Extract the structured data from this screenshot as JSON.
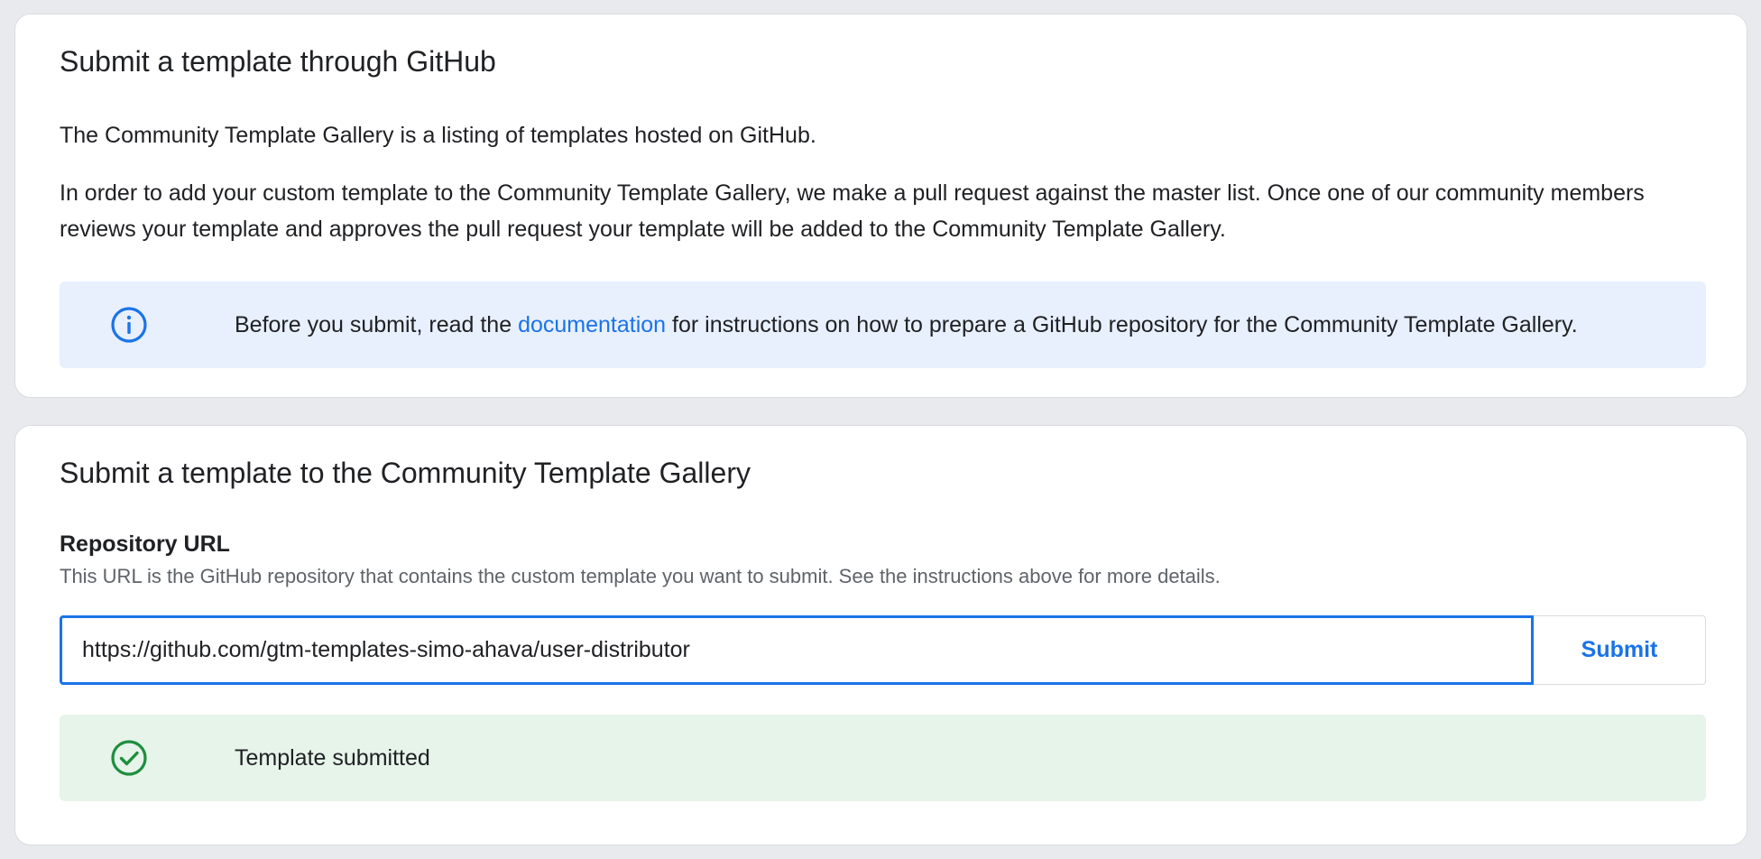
{
  "github_section": {
    "title": "Submit a template through GitHub",
    "intro": "The Community Template Gallery is a listing of templates hosted on GitHub.",
    "detail": "In order to add your custom template to the Community Template Gallery, we make a pull request against the master list. Once one of our community members reviews your template and approves the pull request your template will be added to the Community Template Gallery.",
    "notice": {
      "icon": "info-icon",
      "text_before": "Before you submit, read the ",
      "link_text": "documentation",
      "text_after": " for instructions on how to prepare a GitHub repository for the Community Template Gallery."
    }
  },
  "submit_section": {
    "title": "Submit a template to the Community Template Gallery",
    "field_label": "Repository URL",
    "field_help": "This URL is the GitHub repository that contains the custom template you want to submit. See the instructions above for more details.",
    "url_value": "https://github.com/gtm-templates-simo-ahava/user-distributor",
    "submit_label": "Submit",
    "status": {
      "icon": "check-circle-icon",
      "text": "Template submitted"
    }
  },
  "colors": {
    "accent": "#1a73e8",
    "info_background": "#e8f0fe",
    "success": "#1e8e3e",
    "success_background": "#e6f4ea",
    "page_background": "#e8eaed"
  }
}
